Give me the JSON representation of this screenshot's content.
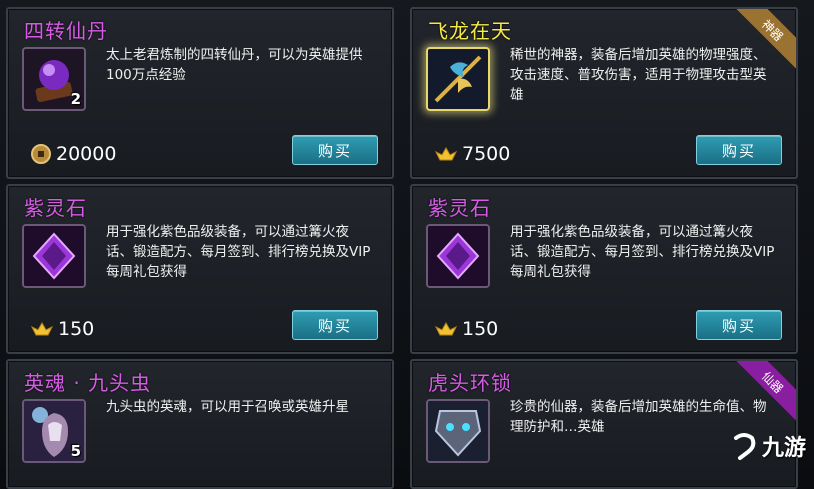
{
  "shop_items": [
    {
      "title": "四转仙丹",
      "title_color": "#d65ce6",
      "description": "太上老君炼制的四转仙丹，可以为英雄提供100万点经验",
      "count": "2",
      "currency_icon": "coin-icon",
      "price": "20000",
      "buy_label": "购买",
      "icon": "purple-orb-icon",
      "ribbon": ""
    },
    {
      "title": "飞龙在天",
      "title_color": "#f6ea4a",
      "description": "稀世的神器，装备后增加英雄的物理强度、攻击速度、普攻伤害，适用于物理攻击型英雄",
      "count": "",
      "currency_icon": "gold-ingot-icon",
      "price": "7500",
      "buy_label": "购买",
      "icon": "dragon-spear-icon",
      "ribbon": "神器"
    },
    {
      "title": "紫灵石",
      "title_color": "#d65ce6",
      "description": "用于强化紫色品级装备，可以通过篝火夜话、锻造配方、每月签到、排行榜兑换及VIP每周礼包获得",
      "count": "",
      "currency_icon": "gold-ingot-icon",
      "price": "150",
      "buy_label": "购买",
      "icon": "purple-gem-icon",
      "ribbon": ""
    },
    {
      "title": "紫灵石",
      "title_color": "#d65ce6",
      "description": "用于强化紫色品级装备，可以通过篝火夜话、锻造配方、每月签到、排行榜兑换及VIP每周礼包获得",
      "count": "",
      "currency_icon": "gold-ingot-icon",
      "price": "150",
      "buy_label": "购买",
      "icon": "purple-gem-icon",
      "ribbon": ""
    },
    {
      "title": "英魂 · 九头虫",
      "title_color": "#d65ce6",
      "description": "九头虫的英魂，可以用于召唤或英雄升星",
      "count": "5",
      "currency_icon": "",
      "price": "",
      "buy_label": "",
      "icon": "hero-soul-icon",
      "ribbon": ""
    },
    {
      "title": "虎头环锁",
      "title_color": "#d65ce6",
      "description": "珍贵的仙器，装备后增加英雄的生命值、物理防护和…英雄",
      "count": "",
      "currency_icon": "",
      "price": "",
      "buy_label": "",
      "icon": "tiger-lock-icon",
      "ribbon": "仙器"
    }
  ],
  "watermark": {
    "text": "九游",
    "icon": "jiuyou-logo-icon"
  }
}
